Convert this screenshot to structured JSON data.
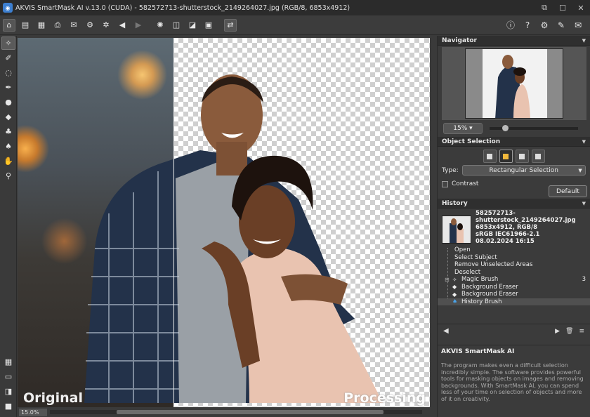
{
  "window": {
    "title": "AKVIS SmartMask AI v.13.0 (CUDA) - 582572713-shutterstock_2149264027.jpg (RGB/8, 6853x4912)",
    "app_icon_glyph": "◉",
    "controls": [
      "⧉",
      "☐",
      "✕"
    ]
  },
  "toolbar": {
    "left_icons": [
      "home-icon",
      "open-file-icon",
      "save-file-icon",
      "print-icon",
      "share-icon",
      "share-alt-icon",
      "settings-alt-icon",
      "undo-icon",
      "redo-icon",
      "run-icon",
      "batch-icon",
      "plugin-icon",
      "text-icon",
      "compare-icon"
    ],
    "right_icons": [
      "about-icon",
      "help-icon",
      "gear-icon",
      "news-icon",
      "chat-icon"
    ]
  },
  "tools": {
    "items": [
      "magic-brush-icon",
      "brush-icon",
      "lasso-icon",
      "color-eyedropper-icon",
      "drop-icon",
      "eraser-icon",
      "stamp-icon",
      "history-brush-icon",
      "hand-icon",
      "zoom-icon"
    ],
    "bottom": [
      "checker-view-icon",
      "split-view-icon",
      "compare-view-icon",
      "bg-color-icon"
    ]
  },
  "canvas": {
    "label_original": "Original",
    "label_processing": "Processing"
  },
  "status": {
    "zoom": "15.0%"
  },
  "navigator": {
    "title": "Navigator",
    "zoom": "15%"
  },
  "object_selection": {
    "title": "Object Selection",
    "type_label": "Type:",
    "type_value": "Rectangular Selection",
    "contrast_label": "Contrast",
    "default_button": "Default"
  },
  "history": {
    "title": "History",
    "snapshot": {
      "line1": "582572713-",
      "line2": "shutterstock_2149264027.jpg",
      "line3": "6853x4912, RGB/8",
      "line4": "sRGB IEC61966-2.1",
      "line5": "08.02.2024 16:15"
    },
    "items": [
      {
        "label": "Open"
      },
      {
        "label": "Select Subject"
      },
      {
        "label": "Remove Unselected Areas"
      },
      {
        "label": "Deselect"
      },
      {
        "label": "Magic Brush",
        "count": "3"
      },
      {
        "label": "Background Eraser"
      },
      {
        "label": "Background Eraser"
      },
      {
        "label": "History Brush"
      }
    ]
  },
  "about": {
    "title": "AKVIS SmartMask AI",
    "text": "The program makes even a difficult selection incredibly simple. The software provides powerful tools for masking objects on images and removing backgrounds. With SmartMask AI, you can spend less of your time on selection of objects and more of it on creativity."
  }
}
